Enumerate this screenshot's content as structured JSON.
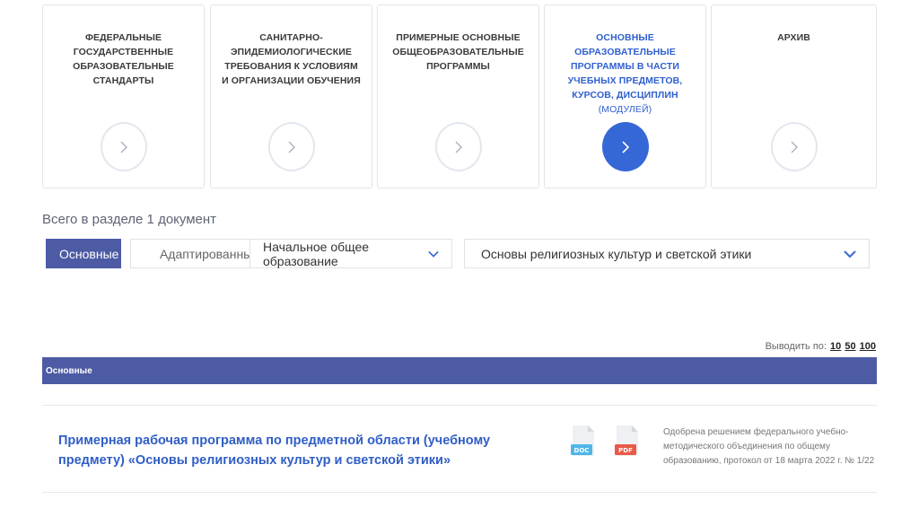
{
  "cards": [
    {
      "title": "Федеральные государственные образовательные стандарты",
      "sub": ""
    },
    {
      "title": "Санитарно-эпидемиологические требования к условиям и организации обучения",
      "sub": ""
    },
    {
      "title": "Примерные основные общеобразовательные программы",
      "sub": ""
    },
    {
      "title": "Основные образовательные программы в части учебных предметов, курсов, дисциплин",
      "sub": "(модулей)",
      "active": true
    },
    {
      "title": "Архив",
      "sub": ""
    }
  ],
  "count_text": "Всего в разделе 1 документ",
  "filters": {
    "basic": "Основные",
    "adapted": "Адаптированные",
    "level": "Начальное общее образование",
    "subject": "Основы религиозных культур и светской этики"
  },
  "perpage": {
    "label": "Выводить по:",
    "opt10": "10",
    "opt50": "50",
    "opt100": "100"
  },
  "section": {
    "title": "Основные"
  },
  "document": {
    "title": "Примерная рабочая программа по предметной области (учебному предмету) «Основы религиозных культур и светской этики»",
    "doc_label": "DOC",
    "pdf_label": "PDF",
    "note": "Одобрена решением федерального учебно-методического объединения по общему образованию, протокол от 18 марта 2022 г. № 1/22"
  },
  "colors": {
    "accent": "#3667d6",
    "bar": "#4c5ba4",
    "doc_icon": "#4fb7e8",
    "pdf_icon": "#e85a48"
  }
}
